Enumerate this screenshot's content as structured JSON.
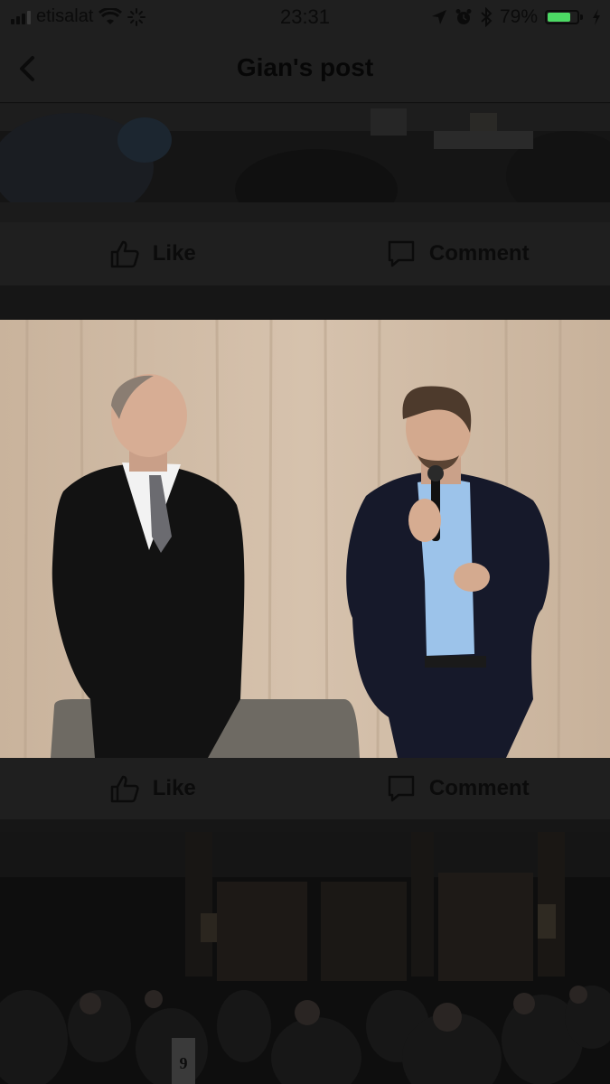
{
  "status_bar": {
    "carrier": "etisalat",
    "time": "23:31",
    "battery_percent": "79%",
    "battery_level": 0.79,
    "icons": [
      "signal-icon",
      "wifi-icon",
      "spinner-icon",
      "location-icon",
      "alarm-icon",
      "bluetooth-icon",
      "battery-icon",
      "charging-icon"
    ]
  },
  "nav": {
    "back_icon": "chevron-left-icon",
    "title": "Gian's post"
  },
  "posts": [
    {
      "actions": {
        "like_label": "Like",
        "comment_label": "Comment"
      }
    },
    {
      "actions": {
        "like_label": "Like",
        "comment_label": "Comment"
      }
    }
  ],
  "photo_bottom": {
    "table_number": "9"
  },
  "colors": {
    "dim_background": "#1f1f1f",
    "divider": "#161616",
    "battery_fill": "#4cd964",
    "curtain": "#cdb8a2"
  }
}
